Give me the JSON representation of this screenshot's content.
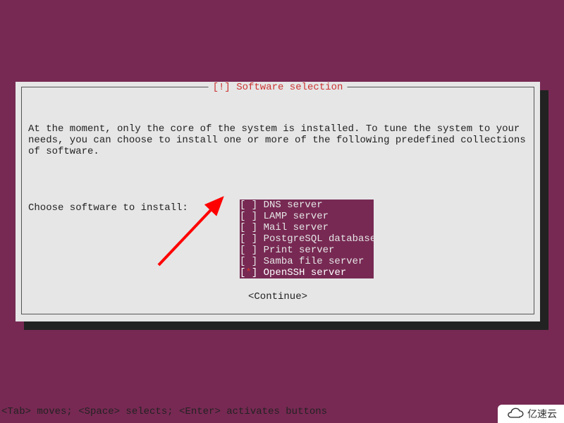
{
  "dialog": {
    "title_prefix": "[!]",
    "title": "Software selection",
    "body_line1": "At the moment, only the core of the system is installed. To tune the system to your needs, you can choose to install one or more of the following predefined collections of software.",
    "prompt": "Choose software to install:",
    "continue_label": "<Continue>"
  },
  "software_list": [
    {
      "label": "DNS server",
      "selected": false,
      "focused": false
    },
    {
      "label": "LAMP server",
      "selected": false,
      "focused": false
    },
    {
      "label": "Mail server",
      "selected": false,
      "focused": false
    },
    {
      "label": "PostgreSQL database",
      "selected": false,
      "focused": false
    },
    {
      "label": "Print server",
      "selected": false,
      "focused": false
    },
    {
      "label": "Samba file server",
      "selected": false,
      "focused": false
    },
    {
      "label": "OpenSSH server",
      "selected": true,
      "focused": true
    }
  ],
  "help_bar": "<Tab> moves; <Space> selects; <Enter> activates buttons",
  "watermark": "亿速云",
  "colors": {
    "background": "#772953",
    "dialog_bg": "#e6e6e6",
    "dialog_text": "#222",
    "accent": "#c33",
    "list_bg": "#772953",
    "list_text": "#e6e6e6"
  },
  "annotation": {
    "type": "arrow",
    "color": "#ff0000",
    "points_to": "software-checkbox-openssh-server"
  }
}
